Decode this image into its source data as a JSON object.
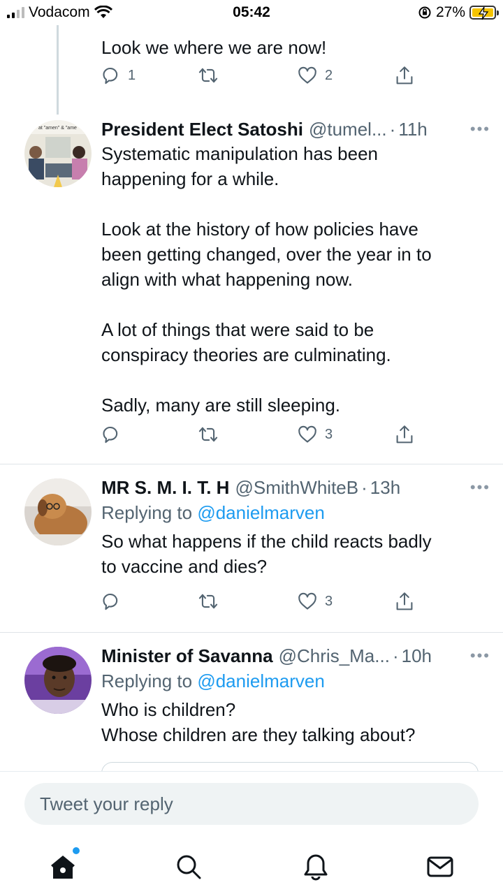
{
  "status_bar": {
    "carrier": "Vodacom",
    "time": "05:42",
    "battery": "27%"
  },
  "tweets": [
    {
      "text": "Look we where we are now!",
      "replies": "1",
      "retweets": "",
      "likes": "2"
    },
    {
      "name": "President Elect Satoshi",
      "handle": "@tumel...",
      "time": "11h",
      "text": "Systematic manipulation has been\nhappening for a while.\n\nLook at the history of how policies have\nbeen getting changed, over the year in to\nalign with what happening now.\n\nA lot of things that were said to be\nconspiracy theories are culminating.\n\nSadly, many are still sleeping.",
      "replies": "",
      "retweets": "",
      "likes": "3"
    },
    {
      "name": "MR S. M. I. T. H",
      "handle": "@SmithWhiteB",
      "time": "13h",
      "replying_prefix": "Replying to",
      "replying_to": "@danielmarven",
      "text": "So what happens if the child reacts badly\nto vaccine and dies?",
      "replies": "",
      "retweets": "",
      "likes": "3"
    },
    {
      "name": "Minister of Savanna",
      "handle": "@Chris_Ma...",
      "time": "10h",
      "replying_prefix": "Replying to",
      "replying_to": "@danielmarven",
      "text": "Who is children?\nWhose children are they talking about?"
    }
  ],
  "reply_box": {
    "placeholder": "Tweet your reply"
  },
  "colors": {
    "link": "#1d9bf0",
    "secondary_text": "#536471",
    "battery": "#f5c400"
  },
  "icons": [
    "wifi-icon",
    "lock-rotation-icon",
    "battery-icon",
    "reply-icon",
    "retweet-icon",
    "like-icon",
    "share-icon",
    "more-icon",
    "home-icon",
    "search-icon",
    "notifications-icon",
    "messages-icon"
  ]
}
